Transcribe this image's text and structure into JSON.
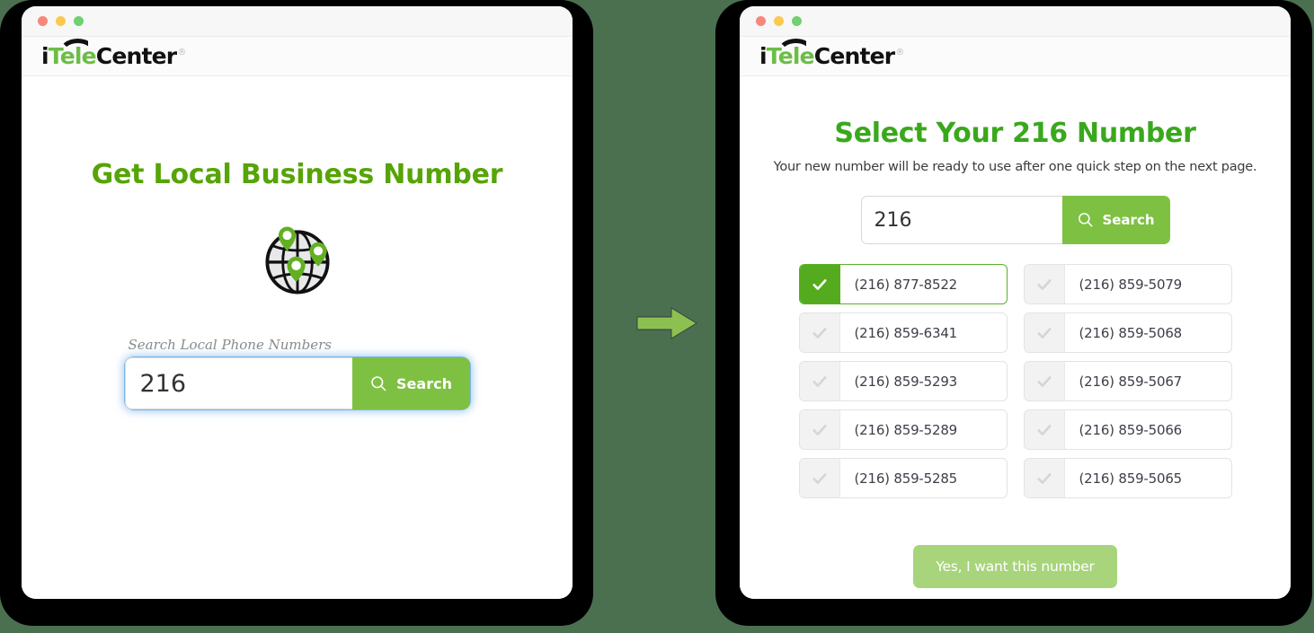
{
  "background_color": "#4a7050",
  "brand": {
    "logo_i": "i",
    "logo_tele": "Tele",
    "logo_center": "Center",
    "logo_registered": "®",
    "green": "#6cbd45"
  },
  "window_controls": {
    "close_color": "#f7877b",
    "minimize_color": "#fac94f",
    "maximize_color": "#6fd16f"
  },
  "left_panel": {
    "title": "Get Local Business Number",
    "title_color": "#56a406",
    "icon_name": "globe-with-location-pins",
    "search": {
      "label": "Search Local Phone Numbers",
      "value": "216",
      "placeholder": "Area code",
      "button_label": "Search",
      "button_color": "#7ec142",
      "focused": true
    }
  },
  "flow_arrow": {
    "icon_name": "right-arrow-icon",
    "color": "#8cc152"
  },
  "right_panel": {
    "title": "Select Your 216 Number",
    "title_color": "#3aa81c",
    "subtitle": "Your new number will be ready to use after one quick step on the next page.",
    "search": {
      "value": "216",
      "placeholder": "Area code",
      "button_label": "Search",
      "button_color": "#7ec142"
    },
    "numbers": [
      {
        "number": "(216) 877-8522",
        "selected": true
      },
      {
        "number": "(216) 859-5079",
        "selected": false
      },
      {
        "number": "(216) 859-6341",
        "selected": false
      },
      {
        "number": "(216) 859-5068",
        "selected": false
      },
      {
        "number": "(216) 859-5293",
        "selected": false
      },
      {
        "number": "(216) 859-5067",
        "selected": false
      },
      {
        "number": "(216) 859-5289",
        "selected": false
      },
      {
        "number": "(216) 859-5066",
        "selected": false
      },
      {
        "number": "(216) 859-5285",
        "selected": false
      },
      {
        "number": "(216) 859-5065",
        "selected": false
      }
    ],
    "confirm": {
      "label": "Yes, I want this number",
      "color": "#a8d47c"
    }
  }
}
